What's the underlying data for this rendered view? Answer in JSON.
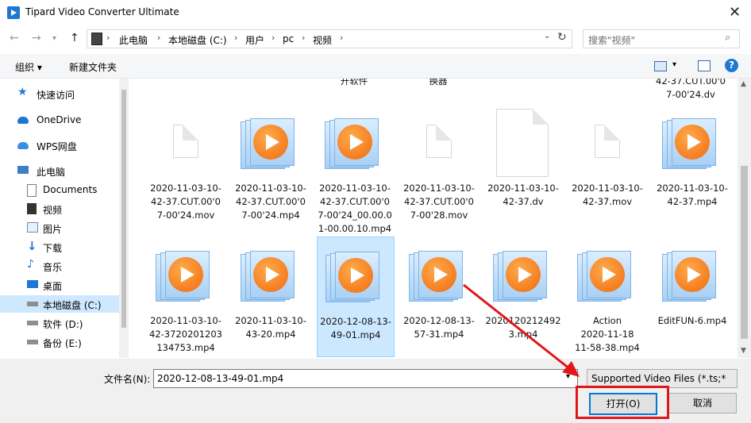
{
  "window": {
    "title": "Tipard Video Converter Ultimate",
    "close_glyph": "✕"
  },
  "address": {
    "crumbs": [
      "此电脑",
      "本地磁盘 (C:)",
      "用户",
      "pc",
      "视频"
    ],
    "separator": "›",
    "search_placeholder": "搜索\"视频\""
  },
  "toolbar": {
    "organize_label": "组织 ▾",
    "new_folder_label": "新建文件夹",
    "help_glyph": "?"
  },
  "sidebar": {
    "items": [
      {
        "label": "快速访问",
        "icon": "star-icon",
        "sub": false
      },
      {
        "label": "OneDrive",
        "icon": "cloud-icon",
        "sub": false
      },
      {
        "label": "WPS网盘",
        "icon": "cloud-icon",
        "sub": false
      },
      {
        "label": "此电脑",
        "icon": "computer-icon",
        "sub": false
      },
      {
        "label": "Documents",
        "icon": "document-icon",
        "sub": true
      },
      {
        "label": "视频",
        "icon": "video-icon",
        "sub": true
      },
      {
        "label": "图片",
        "icon": "picture-icon",
        "sub": true
      },
      {
        "label": "下载",
        "icon": "download-icon",
        "sub": true
      },
      {
        "label": "音乐",
        "icon": "music-icon",
        "sub": true
      },
      {
        "label": "桌面",
        "icon": "desktop-icon",
        "sub": true
      },
      {
        "label": "本地磁盘 (C:)",
        "icon": "drive-icon",
        "sub": true,
        "selected": true
      },
      {
        "label": "软件 (D:)",
        "icon": "drive-icon",
        "sub": true
      },
      {
        "label": "备份 (E:)",
        "icon": "drive-icon",
        "sub": true
      }
    ]
  },
  "partial_names": [
    "开软件",
    "换器",
    "42-37.CUT.00'0\n7-00'24.dv"
  ],
  "files": [
    {
      "name": "2020-11-03-10-\n42-37.CUT.00'0\n7-00'24.mov",
      "type": "doc"
    },
    {
      "name": "2020-11-03-10-\n42-37.CUT.00'0\n7-00'24.mp4",
      "type": "video"
    },
    {
      "name": "2020-11-03-10-\n42-37.CUT.00'0\n7-00'24_00.00.0\n1-00.00.10.mp4",
      "type": "video"
    },
    {
      "name": "2020-11-03-10-\n42-37.CUT.00'0\n7-00'28.mov",
      "type": "doc"
    },
    {
      "name": "2020-11-03-10-\n42-37.dv",
      "type": "doc-large"
    },
    {
      "name": "2020-11-03-10-\n42-37.mov",
      "type": "doc"
    },
    {
      "name": "2020-11-03-10-\n42-37.mp4",
      "type": "video"
    },
    {
      "name": "2020-11-03-10-\n42-3720201203\n134753.mp4",
      "type": "video"
    },
    {
      "name": "2020-11-03-10-\n43-20.mp4",
      "type": "video"
    },
    {
      "name": "2020-12-08-13-\n49-01.mp4",
      "type": "video",
      "selected": true
    },
    {
      "name": "2020-12-08-13-\n57-31.mp4",
      "type": "video"
    },
    {
      "name": "2020120212492\n3.mp4",
      "type": "video"
    },
    {
      "name": "Action\n2020-11-18\n11-58-38.mp4",
      "type": "video"
    },
    {
      "name": "EditFUN-6.mp4",
      "type": "video"
    }
  ],
  "bottom": {
    "filename_label": "文件名(N):",
    "filename_value": "2020-12-08-13-49-01.mp4",
    "filter_value": "Supported Video Files (*.ts;*",
    "open_label": "打开(O)",
    "cancel_label": "取消"
  },
  "colors": {
    "accent": "#1e78d2",
    "highlight": "#e0161b",
    "selection": "#cce8ff"
  }
}
